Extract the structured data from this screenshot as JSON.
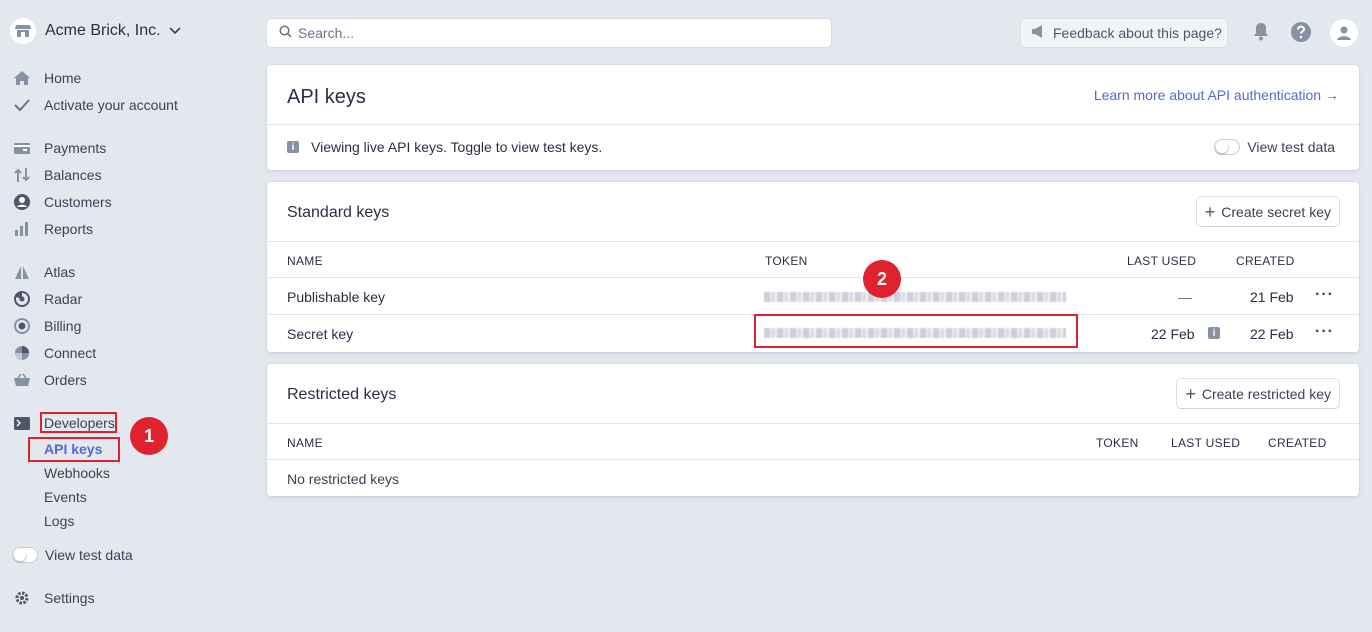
{
  "account": {
    "name": "Acme Brick, Inc."
  },
  "nav": {
    "home": "Home",
    "activate": "Activate your account",
    "payments": "Payments",
    "balances": "Balances",
    "customers": "Customers",
    "reports": "Reports",
    "atlas": "Atlas",
    "radar": "Radar",
    "billing": "Billing",
    "connect": "Connect",
    "orders": "Orders",
    "developers": "Developers",
    "dev_sub": {
      "api_keys": "API keys",
      "webhooks": "Webhooks",
      "events": "Events",
      "logs": "Logs"
    },
    "view_test_data": "View test data",
    "settings": "Settings"
  },
  "annotations": {
    "step1": "1",
    "step2": "2"
  },
  "topbar": {
    "search_placeholder": "Search...",
    "feedback": "Feedback about this page?"
  },
  "header_card": {
    "title": "API keys",
    "learn_more": "Learn more about API authentication",
    "learn_more_arrow": "→",
    "notice": "Viewing live API keys. Toggle to view test keys.",
    "toggle_label": "View test data"
  },
  "standard_keys": {
    "title": "Standard keys",
    "create_button": "Create secret key",
    "columns": {
      "name": "NAME",
      "token": "TOKEN",
      "last_used": "LAST USED",
      "created": "CREATED"
    },
    "rows": [
      {
        "name": "Publishable key",
        "last_used": "—",
        "created": "21 Feb"
      },
      {
        "name": "Secret key",
        "last_used": "22 Feb",
        "created": "22 Feb"
      }
    ]
  },
  "restricted_keys": {
    "title": "Restricted keys",
    "create_button": "Create restricted key",
    "columns": {
      "name": "NAME",
      "token": "TOKEN",
      "last_used": "LAST USED",
      "created": "CREATED"
    },
    "empty": "No restricted keys"
  },
  "colors": {
    "accent": "#5469d4",
    "annotation_red": "#e0222e",
    "background": "#e3e8ee"
  }
}
